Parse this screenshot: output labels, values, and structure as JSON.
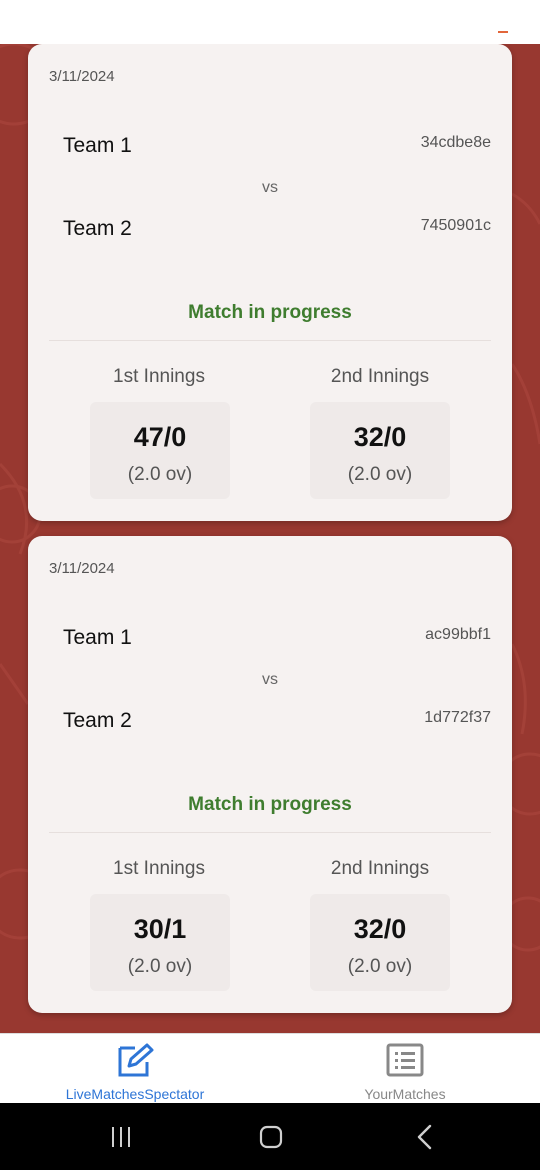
{
  "matches": [
    {
      "date": "3/11/2024",
      "team1": {
        "name": "Team 1",
        "id": "34cdbe8e"
      },
      "vs": "vs",
      "team2": {
        "name": "Team 2",
        "id": "7450901c"
      },
      "status": "Match in progress",
      "innings1": {
        "label": "1st Innings",
        "score": "47/0",
        "overs": "(2.0 ov)"
      },
      "innings2": {
        "label": "2nd Innings",
        "score": "32/0",
        "overs": "(2.0 ov)"
      }
    },
    {
      "date": "3/11/2024",
      "team1": {
        "name": "Team 1",
        "id": "ac99bbf1"
      },
      "vs": "vs",
      "team2": {
        "name": "Team 2",
        "id": "1d772f37"
      },
      "status": "Match in progress",
      "innings1": {
        "label": "1st Innings",
        "score": "30/1",
        "overs": "(2.0 ov)"
      },
      "innings2": {
        "label": "2nd Innings",
        "score": "32/0",
        "overs": "(2.0 ov)"
      }
    }
  ],
  "bottom_nav": {
    "items": [
      {
        "label": "LiveMatchesSpectator",
        "icon": "edit-icon",
        "active": true
      },
      {
        "label": "YourMatches",
        "icon": "list-icon",
        "active": false
      }
    ]
  },
  "colors": {
    "background": "#983830",
    "card": "#f6f2f1",
    "status_green": "#3f7d2f",
    "active_nav": "#2e75d6",
    "inactive_nav": "#888888"
  }
}
